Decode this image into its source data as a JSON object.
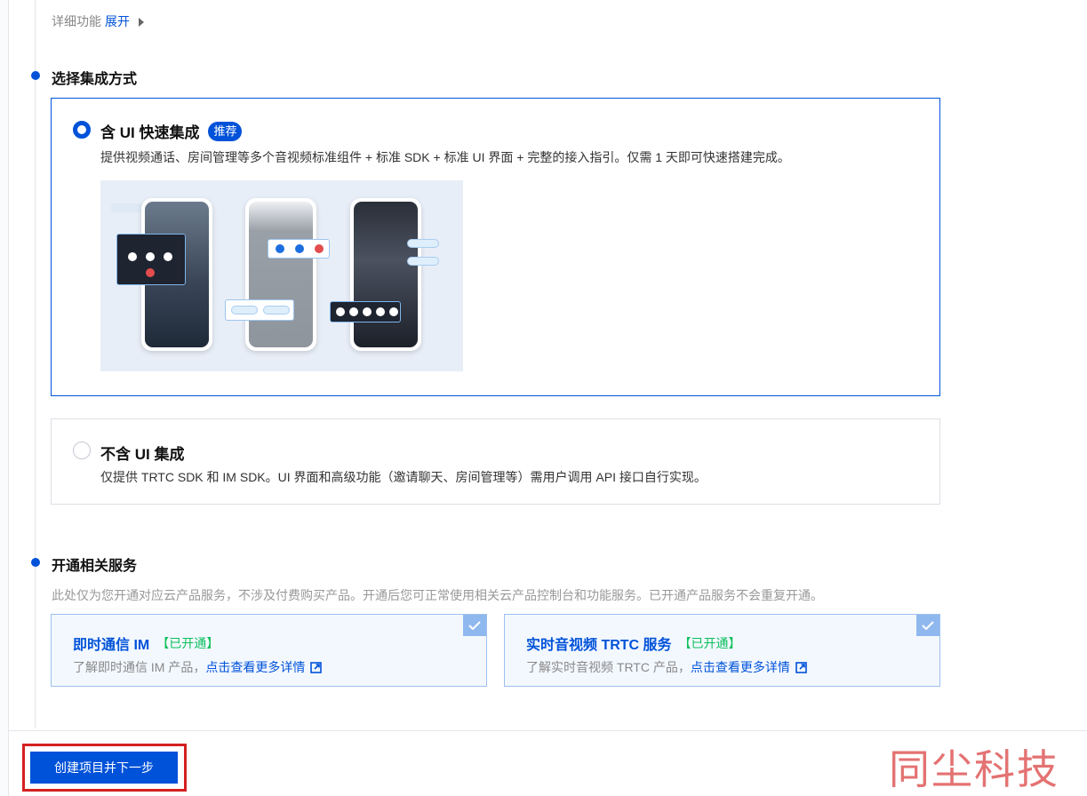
{
  "detail": {
    "label": "详细功能",
    "toggle": "展开"
  },
  "integration": {
    "title": "选择集成方式",
    "options": [
      {
        "title": "含 UI 快速集成",
        "badge": "推荐",
        "desc": "提供视频通话、房间管理等多个音视频标准组件 + 标准 SDK + 标准 UI 界面 + 完整的接入指引。仅需 1 天即可快速搭建完成。",
        "selected": true
      },
      {
        "title": "不含 UI 集成",
        "desc": "仅提供 TRTC SDK 和 IM SDK。UI 界面和高级功能（邀请聊天、房间管理等）需用户调用 API 接口自行实现。",
        "selected": false
      }
    ]
  },
  "services": {
    "title": "开通相关服务",
    "desc": "此处仅为您开通对应云产品服务，不涉及付费购买产品。开通后您可正常使用相关云产品控制台和功能服务。已开通产品服务不会重复开通。",
    "cards": [
      {
        "title": "即时通信 IM",
        "status": "【已开通】",
        "sub": "了解即时通信 IM 产品，",
        "link": "点击查看更多详情"
      },
      {
        "title": "实时音视频 TRTC 服务",
        "status": "【已开通】",
        "sub": "了解实时音视频 TRTC 产品，",
        "link": "点击查看更多详情"
      }
    ]
  },
  "footer": {
    "next_button": "创建项目并下一步"
  },
  "watermark": "同尘科技",
  "colors": {
    "primary": "#0052d9",
    "success": "#0abf5b",
    "highlight": "#d42020"
  }
}
